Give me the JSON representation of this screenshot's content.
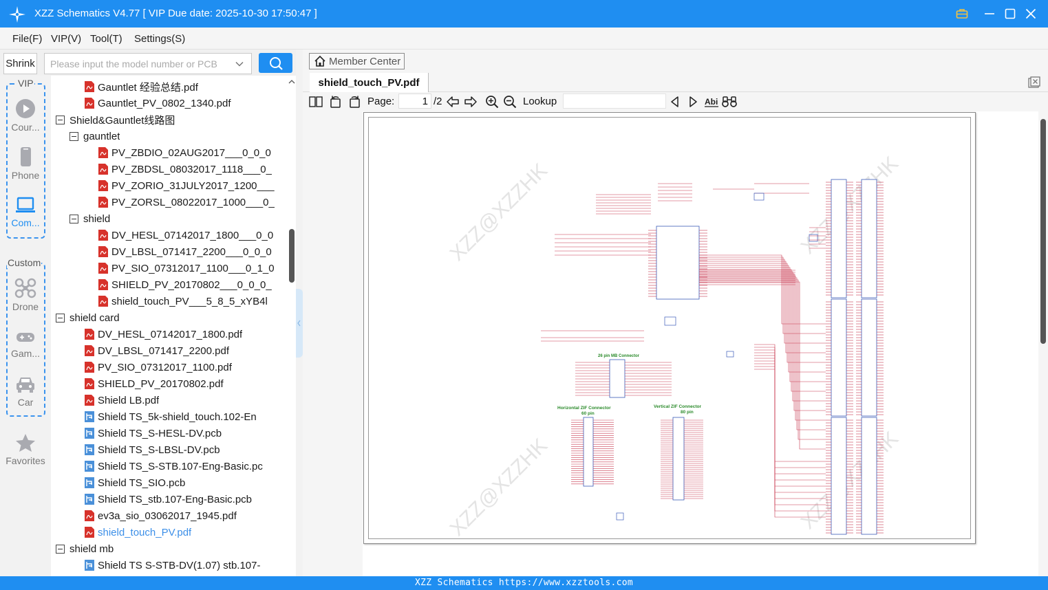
{
  "titlebar": {
    "app_title": "XZZ Schematics V4.77 [ VIP Due date: 2025-10-30 17:50:47 ]"
  },
  "menu": [
    "File(F)",
    "VIP(V)",
    "Tool(T)",
    "Settings(S)"
  ],
  "search": {
    "shrink_label": "Shrink",
    "placeholder": "Please input the model number or PCB",
    "value": ""
  },
  "categories": {
    "vip_label": "VIP",
    "custom_label": "Custom",
    "items": [
      {
        "label": "Cour...",
        "icon": "play-icon"
      },
      {
        "label": "Phone",
        "icon": "phone-icon"
      },
      {
        "label": "Com...",
        "icon": "laptop-icon"
      },
      {
        "label": "Drone",
        "icon": "drone-icon"
      },
      {
        "label": "Gam...",
        "icon": "gamepad-icon"
      },
      {
        "label": "Car",
        "icon": "car-icon"
      },
      {
        "label": "Favorites",
        "icon": "star-icon"
      }
    ]
  },
  "tree": [
    {
      "name": "Gauntlet 经验总结.pdf",
      "type": "pdf",
      "level": 1
    },
    {
      "name": "Gauntlet_PV_0802_1340.pdf",
      "type": "pdf",
      "level": 1
    },
    {
      "name": "Shield&Gauntlet线路图",
      "type": "folder",
      "level": 0
    },
    {
      "name": "gauntlet",
      "type": "folder",
      "level": 1
    },
    {
      "name": "PV_ZBDIO_02AUG2017___0_0_0",
      "type": "pdf",
      "level": 2
    },
    {
      "name": "PV_ZBDSL_08032017_1118___0_",
      "type": "pdf",
      "level": 2
    },
    {
      "name": "PV_ZORIO_31JULY2017_1200___",
      "type": "pdf",
      "level": 2
    },
    {
      "name": "PV_ZORSL_08022017_1000___0_",
      "type": "pdf",
      "level": 2
    },
    {
      "name": "shield",
      "type": "folder",
      "level": 1
    },
    {
      "name": "DV_HESL_07142017_1800___0_0",
      "type": "pdf",
      "level": 2
    },
    {
      "name": "DV_LBSL_071417_2200___0_0_0",
      "type": "pdf",
      "level": 2
    },
    {
      "name": "PV_SIO_07312017_1100___0_1_0",
      "type": "pdf",
      "level": 2
    },
    {
      "name": "SHIELD_PV_20170802___0_0_0_",
      "type": "pdf",
      "level": 2
    },
    {
      "name": "shield_touch_PV___5_8_5_xYB4l",
      "type": "pdf",
      "level": 2
    },
    {
      "name": "shield card",
      "type": "folder",
      "level": 0
    },
    {
      "name": "DV_HESL_07142017_1800.pdf",
      "type": "pdf",
      "level": 1
    },
    {
      "name": "DV_LBSL_071417_2200.pdf",
      "type": "pdf",
      "level": 1
    },
    {
      "name": "PV_SIO_07312017_1100.pdf",
      "type": "pdf",
      "level": 1
    },
    {
      "name": "SHIELD_PV_20170802.pdf",
      "type": "pdf",
      "level": 1
    },
    {
      "name": "Shield LB.pdf",
      "type": "pdf",
      "level": 1
    },
    {
      "name": "Shield TS_5k-shield_touch.102-En",
      "type": "pcb",
      "level": 1
    },
    {
      "name": "Shield TS_S-HESL-DV.pcb",
      "type": "pcb",
      "level": 1
    },
    {
      "name": "Shield TS_S-LBSL-DV.pcb",
      "type": "pcb",
      "level": 1
    },
    {
      "name": "Shield TS_S-STB.107-Eng-Basic.pc",
      "type": "pcb",
      "level": 1
    },
    {
      "name": "Shield TS_SIO.pcb",
      "type": "pcb",
      "level": 1
    },
    {
      "name": "Shield TS_stb.107-Eng-Basic.pcb",
      "type": "pcb",
      "level": 1
    },
    {
      "name": "ev3a_sio_03062017_1945.pdf",
      "type": "pdf",
      "level": 1
    },
    {
      "name": "shield_touch_PV.pdf",
      "type": "pdf",
      "level": 1,
      "selected": true
    },
    {
      "name": "shield mb",
      "type": "folder",
      "level": 0
    },
    {
      "name": "Shield TS S-STB-DV(1.07) stb.107-",
      "type": "pcb",
      "level": 1
    }
  ],
  "viewer": {
    "member_center": "Member Center",
    "tab_title": "shield_touch_PV.pdf",
    "page_label": "Page:",
    "page_current": "1",
    "page_total": "/2",
    "lookup_label": "Lookup",
    "lookup_value": "",
    "watermark": "XZZ@XZZHK",
    "schematic_labels": {
      "mb_connector": "26 pin MB Connector",
      "hzif_title": "Horizontal ZIF Connector",
      "hzif_pins": "60 pin",
      "vzif_title": "Vertical ZIF Connector",
      "vzif_pins": "80 pin"
    }
  },
  "statusbar": "XZZ Schematics https://www.xzztools.com",
  "colors": {
    "accent": "#1f8ef1",
    "pdf_red": "#d7322b",
    "pcb_blue": "#4a90d9",
    "wire_red": "#c8374f",
    "label_green": "#2a8a2a"
  }
}
